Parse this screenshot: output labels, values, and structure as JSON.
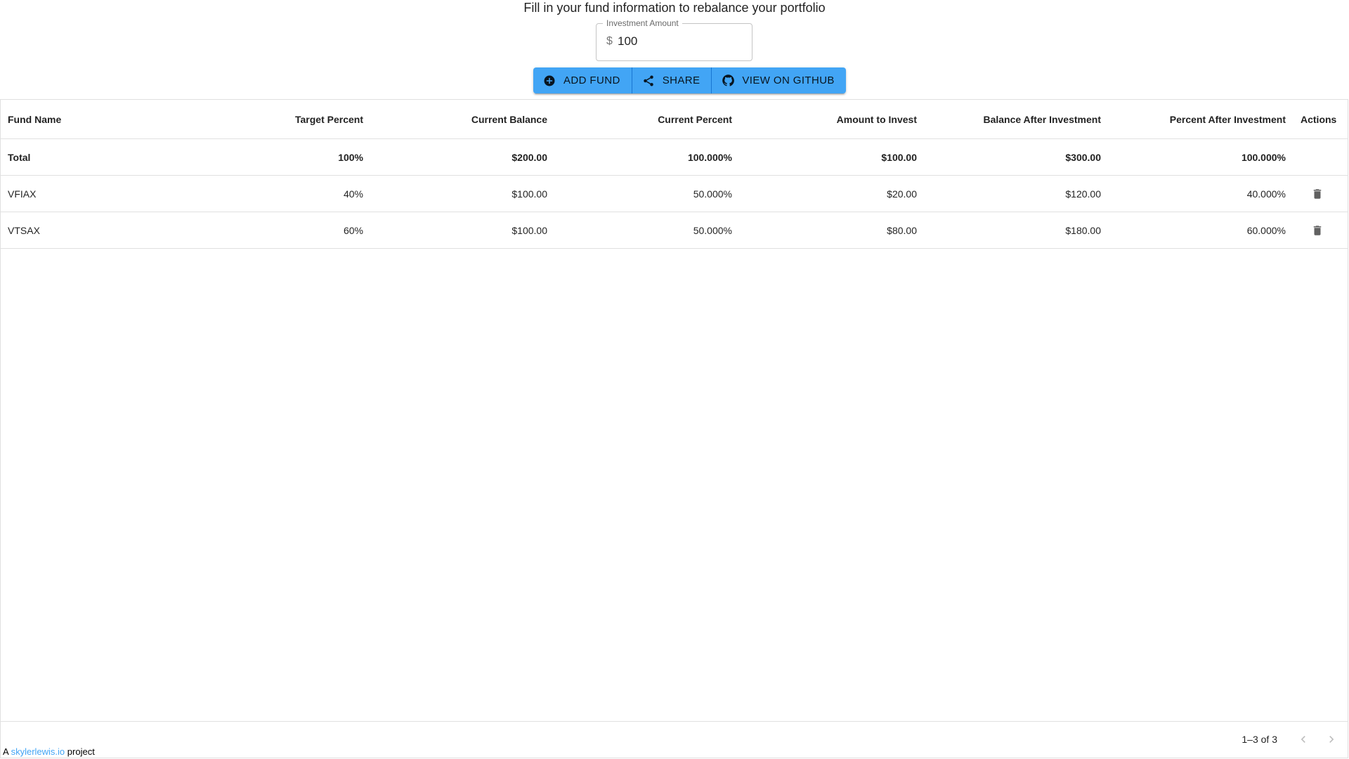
{
  "header": {
    "title": "Fill in your fund information to rebalance your portfolio"
  },
  "investment": {
    "label": "Investment Amount",
    "currency_symbol": "$",
    "value": "100"
  },
  "toolbar": {
    "add_fund_label": "ADD FUND",
    "share_label": "SHARE",
    "github_label": "VIEW ON GITHUB",
    "accent_color": "#42a5f5"
  },
  "table": {
    "columns": {
      "fund_name": "Fund Name",
      "target_percent": "Target Percent",
      "current_balance": "Current Balance",
      "current_percent": "Current Percent",
      "amount_to_invest": "Amount to Invest",
      "balance_after": "Balance After Investment",
      "percent_after": "Percent After Investment",
      "actions": "Actions"
    },
    "total": {
      "name": "Total",
      "target_percent": "100%",
      "current_balance": "$200.00",
      "current_percent": "100.000%",
      "amount_to_invest": "$100.00",
      "balance_after": "$300.00",
      "percent_after": "100.000%"
    },
    "rows": [
      {
        "name": "VFIAX",
        "target_percent": "40%",
        "current_balance": "$100.00",
        "current_percent": "50.000%",
        "amount_to_invest": "$20.00",
        "balance_after": "$120.00",
        "percent_after": "40.000%",
        "action_icon": "trash-icon"
      },
      {
        "name": "VTSAX",
        "target_percent": "60%",
        "current_balance": "$100.00",
        "current_percent": "50.000%",
        "amount_to_invest": "$80.00",
        "balance_after": "$180.00",
        "percent_after": "60.000%",
        "action_icon": "trash-icon"
      }
    ],
    "pagination": {
      "text": "1–3 of 3"
    }
  },
  "footer": {
    "prefix": "A",
    "link_text": "skylerlewis.io",
    "suffix": "project",
    "link_color": "#42a5f5"
  }
}
